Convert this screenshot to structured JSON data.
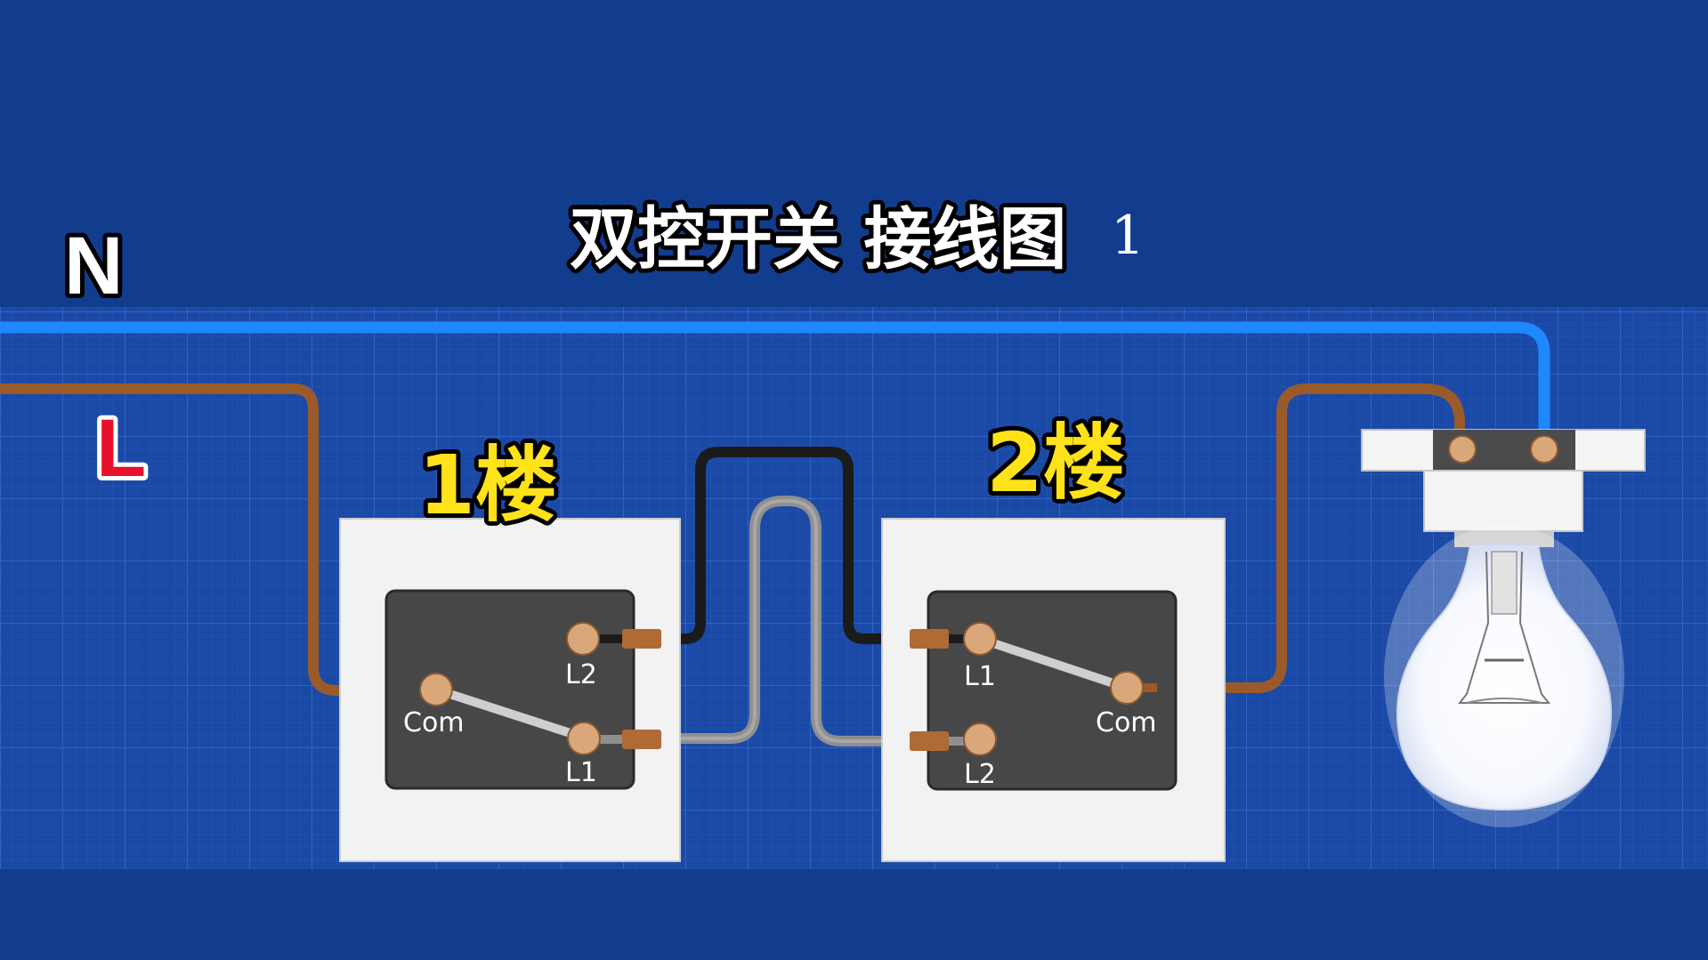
{
  "title": {
    "main": "双控开关 接线图",
    "suffix": "1"
  },
  "wires": {
    "neutral_label": "N",
    "live_label": "L"
  },
  "switch_1": {
    "floor_label": "1楼",
    "terminals": {
      "com": "Com",
      "l1": "L1",
      "l2": "L2"
    }
  },
  "switch_2": {
    "floor_label": "2楼",
    "terminals": {
      "com": "Com",
      "l1": "L1",
      "l2": "L2"
    }
  },
  "colors": {
    "background": "#123c8e",
    "grid_panel": "#1b4aa6",
    "neutral_wire": "#1e88ff",
    "live_wire": "#9a5a2a",
    "traveler_black": "#1b1b1b",
    "traveler_gray": "#8f8f8f",
    "label_yellow": "#ffe21a",
    "label_red": "#e8102a"
  }
}
